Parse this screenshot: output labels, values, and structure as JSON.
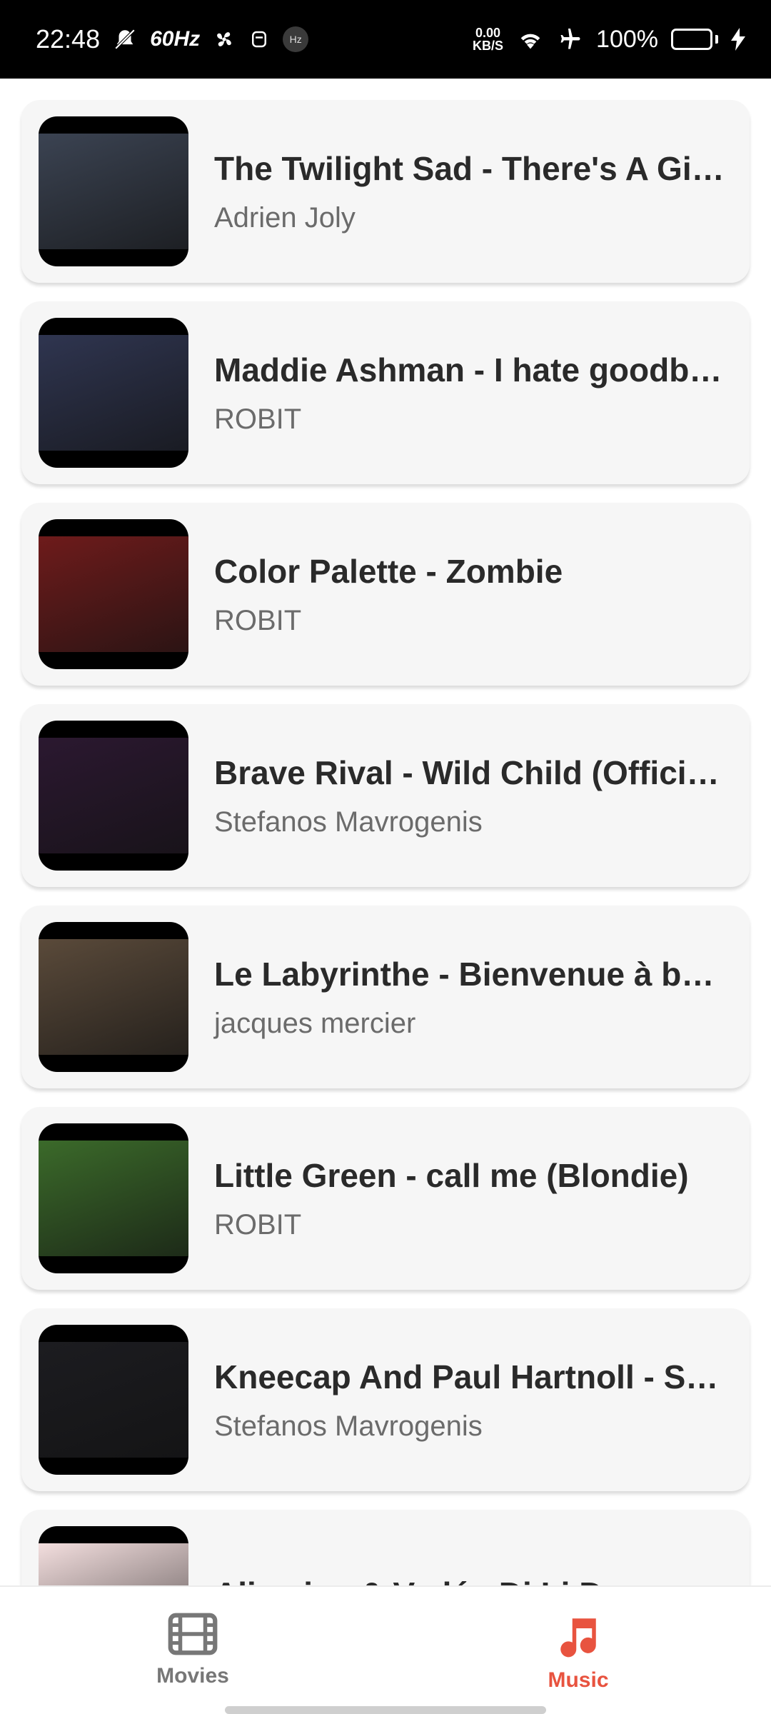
{
  "status_bar": {
    "time": "22:48",
    "refresh_rate": "60Hz",
    "hz_badge": "Hz",
    "net_speed_value": "0.00",
    "net_speed_unit": "KB/S",
    "battery": "100%",
    "battery_level": 1.0
  },
  "tracks": [
    {
      "title": "The Twilight Sad - There's A Girl...",
      "artist": "Adrien Joly",
      "thumb_color": "#3b4352"
    },
    {
      "title": "Maddie Ashman - I hate goodby...",
      "artist": "ROBIT",
      "thumb_color": "#2f3550"
    },
    {
      "title": "Color Palette - Zombie",
      "artist": "ROBIT",
      "thumb_color": "#6e1b1b"
    },
    {
      "title": "Brave Rival - Wild Child (Official ...",
      "artist": "Stefanos Mavrogenis",
      "thumb_color": "#2b1830"
    },
    {
      "title": "Le Labyrinthe - Bienvenue à bor...",
      "artist": "jacques mercier",
      "thumb_color": "#5a4a3a"
    },
    {
      "title": "Little Green - call me (Blondie)",
      "artist": "ROBIT",
      "thumb_color": "#3b6a2a"
    },
    {
      "title": "Kneecap And Paul Hartnoll - Sa...",
      "artist": "Stefanos Mavrogenis",
      "thumb_color": "#1c1c20"
    },
    {
      "title": "Alizarina & Vadé - Di Li Do",
      "artist": "",
      "thumb_color": "#f3dede"
    }
  ],
  "nav": {
    "movies_label": "Movies",
    "music_label": "Music",
    "active": "Music",
    "active_color": "#e8533f",
    "inactive_color": "#777777"
  }
}
